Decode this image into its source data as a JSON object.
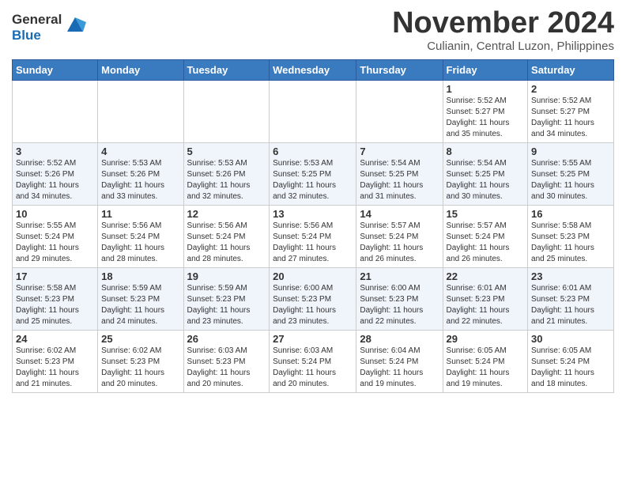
{
  "header": {
    "logo": {
      "line1": "General",
      "line2": "Blue"
    },
    "month": "November 2024",
    "location": "Culianin, Central Luzon, Philippines"
  },
  "weekdays": [
    "Sunday",
    "Monday",
    "Tuesday",
    "Wednesday",
    "Thursday",
    "Friday",
    "Saturday"
  ],
  "weeks": [
    [
      {
        "day": "",
        "info": ""
      },
      {
        "day": "",
        "info": ""
      },
      {
        "day": "",
        "info": ""
      },
      {
        "day": "",
        "info": ""
      },
      {
        "day": "",
        "info": ""
      },
      {
        "day": "1",
        "info": "Sunrise: 5:52 AM\nSunset: 5:27 PM\nDaylight: 11 hours\nand 35 minutes."
      },
      {
        "day": "2",
        "info": "Sunrise: 5:52 AM\nSunset: 5:27 PM\nDaylight: 11 hours\nand 34 minutes."
      }
    ],
    [
      {
        "day": "3",
        "info": "Sunrise: 5:52 AM\nSunset: 5:26 PM\nDaylight: 11 hours\nand 34 minutes."
      },
      {
        "day": "4",
        "info": "Sunrise: 5:53 AM\nSunset: 5:26 PM\nDaylight: 11 hours\nand 33 minutes."
      },
      {
        "day": "5",
        "info": "Sunrise: 5:53 AM\nSunset: 5:26 PM\nDaylight: 11 hours\nand 32 minutes."
      },
      {
        "day": "6",
        "info": "Sunrise: 5:53 AM\nSunset: 5:25 PM\nDaylight: 11 hours\nand 32 minutes."
      },
      {
        "day": "7",
        "info": "Sunrise: 5:54 AM\nSunset: 5:25 PM\nDaylight: 11 hours\nand 31 minutes."
      },
      {
        "day": "8",
        "info": "Sunrise: 5:54 AM\nSunset: 5:25 PM\nDaylight: 11 hours\nand 30 minutes."
      },
      {
        "day": "9",
        "info": "Sunrise: 5:55 AM\nSunset: 5:25 PM\nDaylight: 11 hours\nand 30 minutes."
      }
    ],
    [
      {
        "day": "10",
        "info": "Sunrise: 5:55 AM\nSunset: 5:24 PM\nDaylight: 11 hours\nand 29 minutes."
      },
      {
        "day": "11",
        "info": "Sunrise: 5:56 AM\nSunset: 5:24 PM\nDaylight: 11 hours\nand 28 minutes."
      },
      {
        "day": "12",
        "info": "Sunrise: 5:56 AM\nSunset: 5:24 PM\nDaylight: 11 hours\nand 28 minutes."
      },
      {
        "day": "13",
        "info": "Sunrise: 5:56 AM\nSunset: 5:24 PM\nDaylight: 11 hours\nand 27 minutes."
      },
      {
        "day": "14",
        "info": "Sunrise: 5:57 AM\nSunset: 5:24 PM\nDaylight: 11 hours\nand 26 minutes."
      },
      {
        "day": "15",
        "info": "Sunrise: 5:57 AM\nSunset: 5:24 PM\nDaylight: 11 hours\nand 26 minutes."
      },
      {
        "day": "16",
        "info": "Sunrise: 5:58 AM\nSunset: 5:23 PM\nDaylight: 11 hours\nand 25 minutes."
      }
    ],
    [
      {
        "day": "17",
        "info": "Sunrise: 5:58 AM\nSunset: 5:23 PM\nDaylight: 11 hours\nand 25 minutes."
      },
      {
        "day": "18",
        "info": "Sunrise: 5:59 AM\nSunset: 5:23 PM\nDaylight: 11 hours\nand 24 minutes."
      },
      {
        "day": "19",
        "info": "Sunrise: 5:59 AM\nSunset: 5:23 PM\nDaylight: 11 hours\nand 23 minutes."
      },
      {
        "day": "20",
        "info": "Sunrise: 6:00 AM\nSunset: 5:23 PM\nDaylight: 11 hours\nand 23 minutes."
      },
      {
        "day": "21",
        "info": "Sunrise: 6:00 AM\nSunset: 5:23 PM\nDaylight: 11 hours\nand 22 minutes."
      },
      {
        "day": "22",
        "info": "Sunrise: 6:01 AM\nSunset: 5:23 PM\nDaylight: 11 hours\nand 22 minutes."
      },
      {
        "day": "23",
        "info": "Sunrise: 6:01 AM\nSunset: 5:23 PM\nDaylight: 11 hours\nand 21 minutes."
      }
    ],
    [
      {
        "day": "24",
        "info": "Sunrise: 6:02 AM\nSunset: 5:23 PM\nDaylight: 11 hours\nand 21 minutes."
      },
      {
        "day": "25",
        "info": "Sunrise: 6:02 AM\nSunset: 5:23 PM\nDaylight: 11 hours\nand 20 minutes."
      },
      {
        "day": "26",
        "info": "Sunrise: 6:03 AM\nSunset: 5:23 PM\nDaylight: 11 hours\nand 20 minutes."
      },
      {
        "day": "27",
        "info": "Sunrise: 6:03 AM\nSunset: 5:24 PM\nDaylight: 11 hours\nand 20 minutes."
      },
      {
        "day": "28",
        "info": "Sunrise: 6:04 AM\nSunset: 5:24 PM\nDaylight: 11 hours\nand 19 minutes."
      },
      {
        "day": "29",
        "info": "Sunrise: 6:05 AM\nSunset: 5:24 PM\nDaylight: 11 hours\nand 19 minutes."
      },
      {
        "day": "30",
        "info": "Sunrise: 6:05 AM\nSunset: 5:24 PM\nDaylight: 11 hours\nand 18 minutes."
      }
    ]
  ]
}
